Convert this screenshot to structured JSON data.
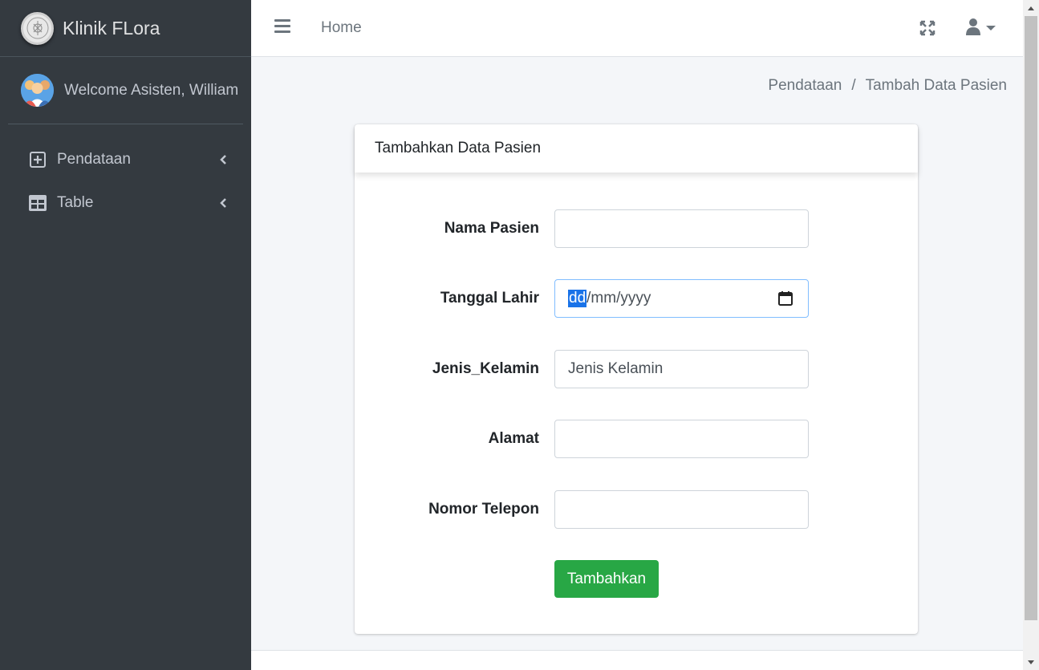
{
  "sidebar": {
    "brand": "Klinik FLora",
    "user": "Welcome Asisten, William",
    "items": [
      {
        "label": "Pendataan",
        "icon": "plus-square-icon"
      },
      {
        "label": "Table",
        "icon": "table-icon"
      }
    ]
  },
  "topnav": {
    "home": "Home"
  },
  "breadcrumb": {
    "parent": "Pendataan",
    "separator": "/",
    "current": "Tambah Data Pasien"
  },
  "card": {
    "title": "Tambahkan Data Pasien"
  },
  "form": {
    "nama_label": "Nama Pasien",
    "nama_value": "",
    "tanggal_label": "Tanggal Lahir",
    "tanggal_dd": "dd",
    "tanggal_rest": "/mm/yyyy",
    "jk_label": "Jenis_Kelamin",
    "jk_placeholder": "Jenis Kelamin",
    "alamat_label": "Alamat",
    "alamat_value": "",
    "telp_label": "Nomor Telepon",
    "telp_value": "",
    "submit": "Tambahkan"
  },
  "colors": {
    "sidebar_bg": "#343a40",
    "submit_bg": "#28a745",
    "date_highlight": "#1a73e8"
  }
}
